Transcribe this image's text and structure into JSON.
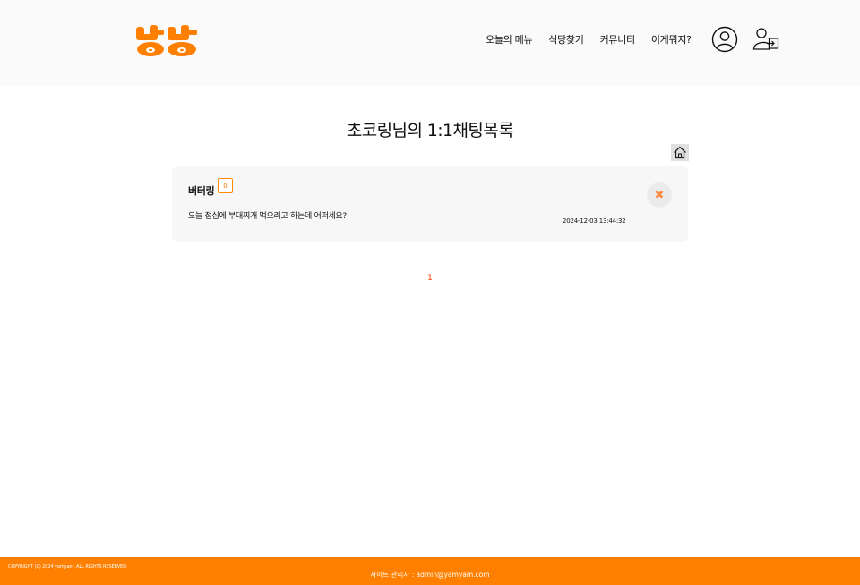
{
  "header": {
    "logo_text": "냠냠",
    "nav": [
      "오늘의 메뉴",
      "식당찾기",
      "커뮤니티",
      "이게뭐지?"
    ],
    "icons": {
      "profile": "user-circle-icon",
      "login": "user-login-icon"
    }
  },
  "page": {
    "title": "초코링님의 1:1채팅목록",
    "home_icon": "home-icon"
  },
  "chats": [
    {
      "name": "버터링",
      "unread": "0",
      "message": "오늘 점심에 부대찌개 먹으려고 하는데 어떠세요?",
      "time": "2024-12-03 13:44:32",
      "close_icon": "close-icon"
    }
  ],
  "pagination": {
    "pages": [
      "1"
    ],
    "current": "1"
  },
  "footer": {
    "copyright": "COPYRIGHT (C) 2024 yamyam. ALL RIGHTS RESERVED.",
    "admin": "사이트 관리자 : admin@yamyam.com"
  },
  "colors": {
    "brand": "#ff7f00",
    "accent_text": "#ff3b00"
  }
}
